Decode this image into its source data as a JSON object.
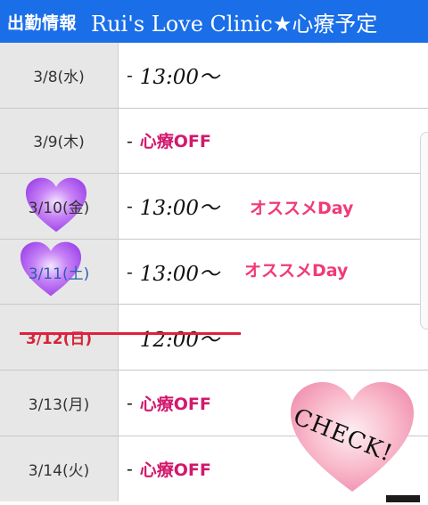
{
  "header": {
    "label": "出勤情報",
    "title": "Rui's Love Clinic★心療予定"
  },
  "dash": "-",
  "rows": [
    {
      "date": "3/8(水)",
      "time": "13:00〜"
    },
    {
      "date": "3/9(木)",
      "off": "心療OFF"
    },
    {
      "date": "3/10(金)",
      "time": "13:00〜",
      "recommend": "オススメDay"
    },
    {
      "date": "3/11(土)",
      "time": "13:00〜",
      "recommend": "オススメDay"
    },
    {
      "date": "3/12(日)",
      "time": "12:00〜",
      "struck": true
    },
    {
      "date": "3/13(月)",
      "off": "心療OFF"
    },
    {
      "date": "3/14(火)",
      "off": "心療OFF"
    }
  ],
  "sticker": {
    "text": "CHECK!"
  },
  "colors": {
    "header": "#1a6ee8",
    "off_text": "#d2186d",
    "recommend_text": "#f13a78",
    "strike": "#e0203c",
    "heart_purple": "#b24cf0",
    "heart_pink": "#f8b0c8"
  }
}
